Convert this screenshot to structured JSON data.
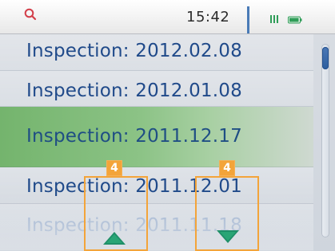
{
  "status_bar": {
    "time": "15:42",
    "icons": {
      "search": "search-icon",
      "signal": "signal-bars-icon",
      "battery": "battery-icon"
    }
  },
  "inspections": [
    {
      "label": "Inspection: 2012.02.08"
    },
    {
      "label": "Inspection: 2012.01.08"
    },
    {
      "label": "Inspection: 2011.12.17"
    },
    {
      "label": "Inspection: 2011.12.01"
    },
    {
      "label": "Inspection: 2011.11.18"
    }
  ],
  "selected_index": 2,
  "overlays": {
    "up_badge": "4",
    "down_badge": "4"
  },
  "colors": {
    "accent_blue": "#2c5e9e",
    "selection_green": "#7ab873",
    "overlay_orange": "#f3a43a",
    "arrow_green": "#1f8f68"
  }
}
